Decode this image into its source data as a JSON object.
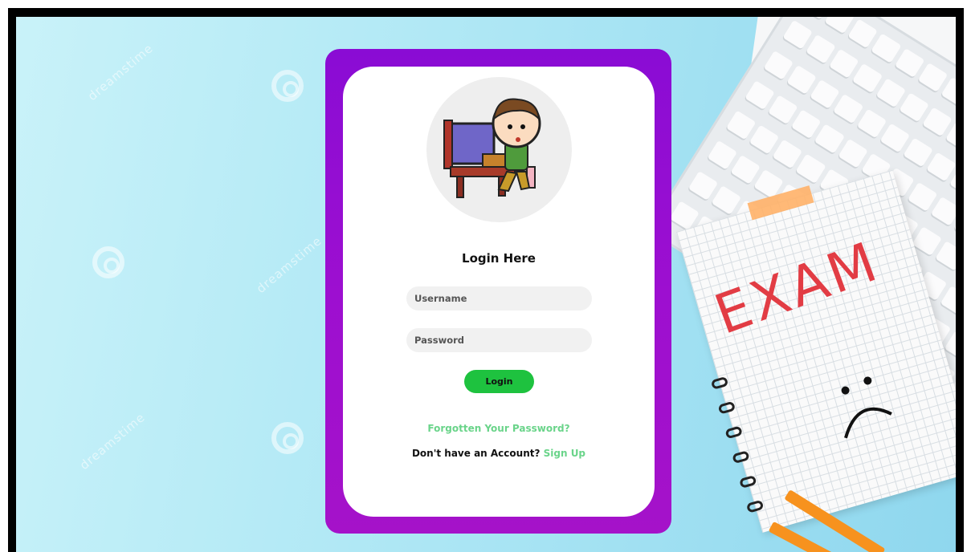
{
  "form": {
    "title": "Login Here",
    "username_placeholder": "Username",
    "password_placeholder": "Password",
    "username_value": "",
    "password_value": "",
    "login_label": "Login",
    "forgot_label": "Forgotten Your Password?",
    "no_account_text": "Don't have an Account?",
    "signup_label": "Sign Up"
  },
  "background": {
    "watermark_text": "dreamstime",
    "notebook_text": "EXAM"
  },
  "colors": {
    "card_frame": "#9b0ed2",
    "login_button": "#1ec23f",
    "link": "#6ad48a",
    "background": "#b7ebf6"
  },
  "icons": {
    "avatar": "kid-at-computer-illustration",
    "watermark": "spiral-logo-icon"
  }
}
